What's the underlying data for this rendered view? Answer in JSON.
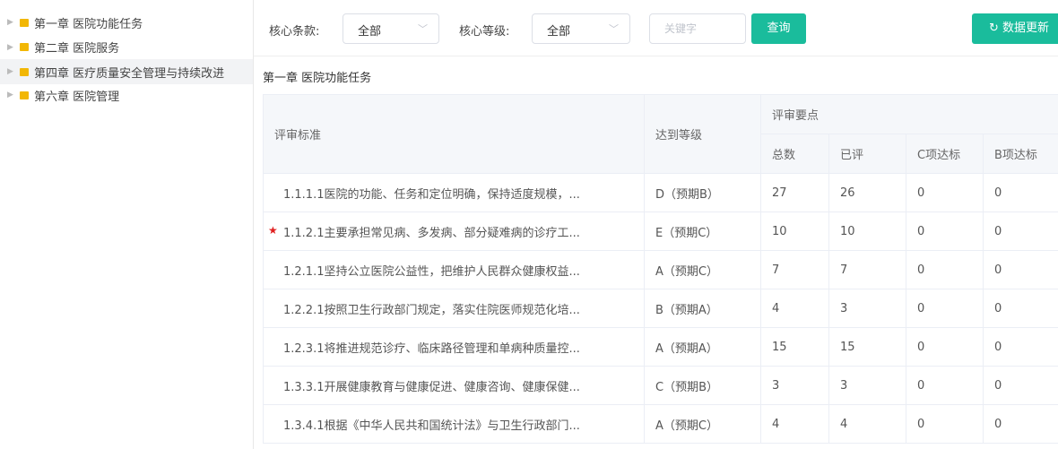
{
  "sidebar": {
    "items": [
      {
        "label": "第一章 医院功能任务"
      },
      {
        "label": "第二章 医院服务"
      },
      {
        "label": "第四章 医疗质量安全管理与持续改进"
      },
      {
        "label": "第六章 医院管理"
      }
    ],
    "active_index": 2
  },
  "filters": {
    "core_clause_label": "核心条款:",
    "core_clause_value": "全部",
    "core_level_label": "核心等级:",
    "core_level_value": "全部",
    "keyword_placeholder": "关键字",
    "query_button": "查询",
    "refresh_button": "数据更新"
  },
  "section_title": "第一章 医院功能任务",
  "table": {
    "headers": {
      "standard": "评审标准",
      "level": "达到等级",
      "points": "评审要点",
      "total": "总数",
      "reviewed": "已评",
      "c_pass": "C项达标",
      "b_pass": "B项达标"
    },
    "rows": [
      {
        "standard": "1.1.1.1医院的功能、任务和定位明确，保持适度规模，...",
        "level": "D（预期B）",
        "total": "27",
        "reviewed": "26",
        "c": "0",
        "b": "0",
        "starred": false
      },
      {
        "standard": "1.1.2.1主要承担常见病、多发病、部分疑难病的诊疗工...",
        "level": "E（预期C）",
        "total": "10",
        "reviewed": "10",
        "c": "0",
        "b": "0",
        "starred": true
      },
      {
        "standard": "1.2.1.1坚持公立医院公益性，把维护人民群众健康权益...",
        "level": "A（预期C）",
        "total": "7",
        "reviewed": "7",
        "c": "0",
        "b": "0",
        "starred": false
      },
      {
        "standard": "1.2.2.1按照卫生行政部门规定，落实住院医师规范化培...",
        "level": "B（预期A）",
        "total": "4",
        "reviewed": "3",
        "c": "0",
        "b": "0",
        "starred": false
      },
      {
        "standard": "1.2.3.1将推进规范诊疗、临床路径管理和单病种质量控...",
        "level": "A（预期A）",
        "total": "15",
        "reviewed": "15",
        "c": "0",
        "b": "0",
        "starred": false
      },
      {
        "standard": "1.3.3.1开展健康教育与健康促进、健康咨询、健康保健...",
        "level": "C（预期B）",
        "total": "3",
        "reviewed": "3",
        "c": "0",
        "b": "0",
        "starred": false
      },
      {
        "standard": "1.3.4.1根据《中华人民共和国统计法》与卫生行政部门...",
        "level": "A（预期C）",
        "total": "4",
        "reviewed": "4",
        "c": "0",
        "b": "0",
        "starred": false
      }
    ]
  },
  "colors": {
    "accent": "#1abc9c",
    "folder": "#f2b705",
    "star": "#e02020"
  }
}
